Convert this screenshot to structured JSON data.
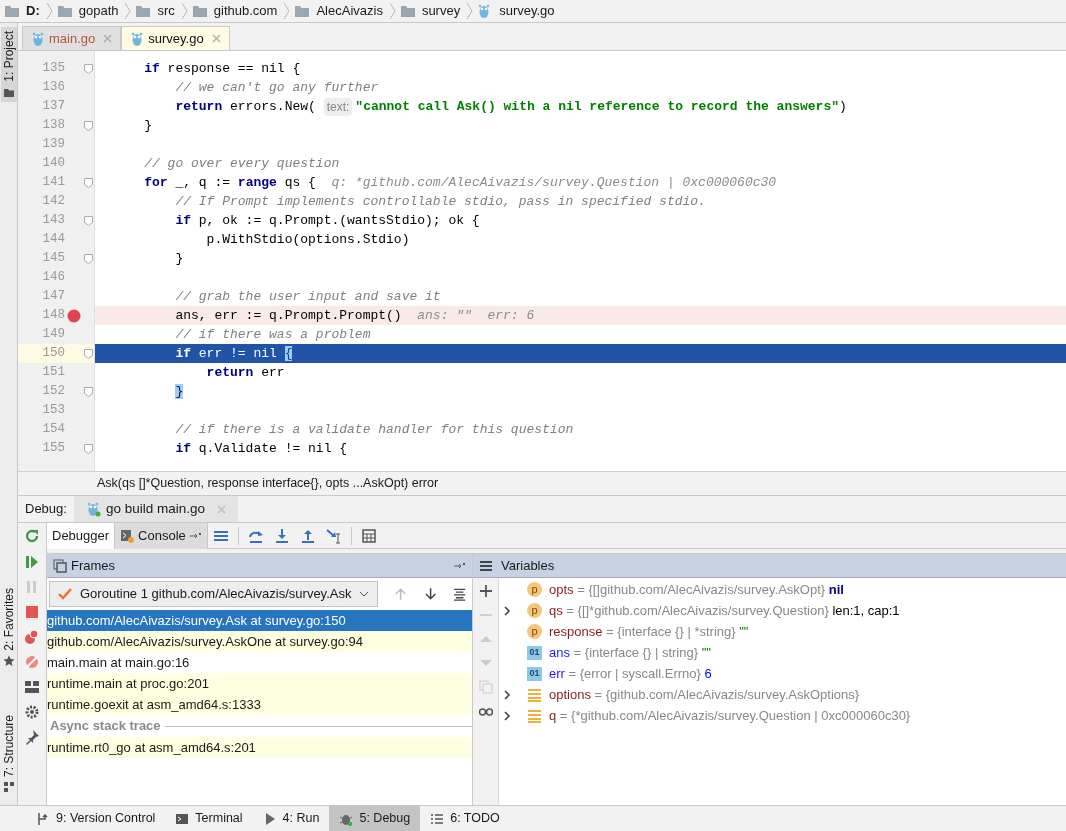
{
  "breadcrumbs": [
    {
      "label": "D:",
      "kind": "drive"
    },
    {
      "label": "gopath",
      "kind": "folder"
    },
    {
      "label": "src",
      "kind": "folder"
    },
    {
      "label": "github.com",
      "kind": "folder"
    },
    {
      "label": "AlecAivazis",
      "kind": "folder"
    },
    {
      "label": "survey",
      "kind": "folder"
    },
    {
      "label": "survey.go",
      "kind": "file"
    }
  ],
  "side_tools": [
    {
      "label": "1: Project",
      "kind": "project"
    },
    {
      "label": "2: Favorites",
      "kind": "favorites"
    },
    {
      "label": "7: Structure",
      "kind": "structure"
    }
  ],
  "editor_tabs": [
    {
      "label": "main.go",
      "selected": false
    },
    {
      "label": "survey.go",
      "selected": true
    }
  ],
  "code_lines": [
    {
      "number": "135",
      "fold": true,
      "breakpoint": false,
      "current": false,
      "segments": [
        {
          "kind": "keyword",
          "t": "    if"
        },
        {
          "kind": "plain",
          "t": " response == nil {"
        }
      ]
    },
    {
      "number": "136",
      "fold": false,
      "breakpoint": false,
      "current": false,
      "segments": [
        {
          "kind": "comment",
          "t": "        // we can't go any further"
        }
      ]
    },
    {
      "number": "137",
      "fold": false,
      "breakpoint": false,
      "current": false,
      "segments": [
        {
          "kind": "keyword",
          "t": "        return"
        },
        {
          "kind": "plain",
          "t": " errors.New( "
        },
        {
          "kind": "inlay",
          "t": "text:"
        },
        {
          "kind": "string",
          "t": "\"cannot call Ask() with a nil reference to record the answers\""
        },
        {
          "kind": "plain",
          "t": ")"
        }
      ]
    },
    {
      "number": "138",
      "fold": true,
      "breakpoint": false,
      "current": false,
      "segments": [
        {
          "kind": "plain",
          "t": "    }"
        }
      ]
    },
    {
      "number": "139",
      "fold": false,
      "breakpoint": false,
      "current": false
    },
    {
      "number": "140",
      "fold": false,
      "breakpoint": false,
      "current": false,
      "segments": [
        {
          "kind": "comment",
          "t": "    // go over every question"
        }
      ]
    },
    {
      "number": "141",
      "fold": true,
      "breakpoint": false,
      "current": false,
      "segments": [
        {
          "kind": "keyword",
          "t": "    for"
        },
        {
          "kind": "plain",
          "t": " _, q := "
        },
        {
          "kind": "keyword",
          "t": "range"
        },
        {
          "kind": "plain",
          "t": " qs {  "
        },
        {
          "kind": "hint",
          "t": "q: *github.com/AlecAivazis/survey.Question | 0xc000060c30"
        }
      ]
    },
    {
      "number": "142",
      "fold": false,
      "breakpoint": false,
      "current": false,
      "segments": [
        {
          "kind": "comment",
          "t": "        // If Prompt implements controllable stdio, pass in specified stdio."
        }
      ]
    },
    {
      "number": "143",
      "fold": true,
      "breakpoint": false,
      "current": false,
      "segments": [
        {
          "kind": "keyword",
          "t": "        if"
        },
        {
          "kind": "plain",
          "t": " p, ok := q.Prompt.(wantsStdio); ok {"
        }
      ]
    },
    {
      "number": "144",
      "fold": false,
      "breakpoint": false,
      "current": false,
      "segments": [
        {
          "kind": "plain",
          "t": "            p.WithStdio(options.Stdio)"
        }
      ]
    },
    {
      "number": "145",
      "fold": true,
      "breakpoint": false,
      "current": false,
      "segments": [
        {
          "kind": "plain",
          "t": "        }"
        }
      ]
    },
    {
      "number": "146",
      "fold": false,
      "breakpoint": false,
      "current": false
    },
    {
      "number": "147",
      "fold": false,
      "breakpoint": false,
      "current": false,
      "segments": [
        {
          "kind": "comment",
          "t": "        // grab the user input and save it"
        }
      ]
    },
    {
      "number": "148",
      "fold": false,
      "breakpoint": true,
      "current": false,
      "segments": [
        {
          "kind": "plain",
          "t": "        ans, err := q.Prompt.Prompt()  "
        },
        {
          "kind": "hint",
          "t": "ans: \"\"  err: 6"
        }
      ]
    },
    {
      "number": "149",
      "fold": false,
      "breakpoint": false,
      "current": false,
      "segments": [
        {
          "kind": "comment",
          "t": "        // if there was a problem"
        }
      ]
    },
    {
      "number": "150",
      "fold": true,
      "breakpoint": false,
      "current": true,
      "segments": [
        {
          "kind": "keyword",
          "t": "        if"
        },
        {
          "kind": "plain",
          "t": " err != nil "
        },
        {
          "kind": "brace",
          "t": "{"
        }
      ]
    },
    {
      "number": "151",
      "fold": false,
      "breakpoint": false,
      "current": false,
      "segments": [
        {
          "kind": "keyword",
          "t": "            return"
        },
        {
          "kind": "plain",
          "t": " err"
        }
      ]
    },
    {
      "number": "152",
      "fold": true,
      "breakpoint": false,
      "current": false,
      "segments": [
        {
          "kind": "brace",
          "t": "        }"
        }
      ]
    },
    {
      "number": "153",
      "fold": false,
      "breakpoint": false,
      "current": false
    },
    {
      "number": "154",
      "fold": false,
      "breakpoint": false,
      "current": false,
      "segments": [
        {
          "kind": "comment",
          "t": "        // if there is a validate handler for this question"
        }
      ]
    },
    {
      "number": "155",
      "fold": true,
      "breakpoint": false,
      "current": false,
      "segments": [
        {
          "kind": "keyword",
          "t": "        if"
        },
        {
          "kind": "plain",
          "t": " q.Validate != nil {"
        }
      ]
    }
  ],
  "signature_hint": "Ask(qs []*Question, response interface{}, opts ...AskOpt) error",
  "debug": {
    "label": "Debug:",
    "session_tab": "go build main.go",
    "view_tabs": [
      {
        "label": "Debugger",
        "selected": true
      },
      {
        "label": "Console",
        "selected": false
      }
    ],
    "frames": {
      "title": "Frames",
      "goroutine": "Goroutine 1 github.com/AlecAivazis/survey.Ask",
      "items": [
        {
          "kind": "library",
          "label": "github.com/AlecAivazis/survey.Ask at survey.go:150",
          "selected": true
        },
        {
          "kind": "library",
          "label": "github.com/AlecAivazis/survey.AskOne at survey.go:94",
          "selected": false
        },
        {
          "kind": "user",
          "label": "main.main at main.go:16",
          "selected": false
        },
        {
          "kind": "library",
          "label": "runtime.main at proc.go:201",
          "selected": false
        },
        {
          "kind": "library",
          "label": "runtime.goexit at asm_amd64.s:1333",
          "selected": false
        },
        {
          "kind": "header",
          "label": "Async stack trace"
        },
        {
          "kind": "library",
          "label": "runtime.rt0_go at asm_amd64.s:201",
          "selected": false
        }
      ]
    },
    "variables": {
      "title": "Variables",
      "items": [
        {
          "kind": "param",
          "badge": "p",
          "expandable": false,
          "name": "opts",
          "type": "= {[]github.com/AlecAivazis/survey.AskOpt}",
          "value": {
            "kind": "nil",
            "text": "nil"
          }
        },
        {
          "kind": "param",
          "badge": "p",
          "expandable": true,
          "name": "qs",
          "type": "= {[]*github.com/AlecAivazis/survey.Question}",
          "value": {
            "kind": "plain",
            "text": "len:1, cap:1"
          }
        },
        {
          "kind": "param",
          "badge": "p",
          "expandable": false,
          "name": "response",
          "type": "= {interface {} | *string}",
          "value": {
            "kind": "string",
            "text": "\"\""
          }
        },
        {
          "kind": "local",
          "badge": "01",
          "expandable": false,
          "name": "ans",
          "type": "= {interface {} | string}",
          "value": {
            "kind": "string",
            "text": "\"\""
          }
        },
        {
          "kind": "local",
          "badge": "01",
          "expandable": false,
          "name": "err",
          "type": "= {error | syscall.Errno}",
          "value": {
            "kind": "number",
            "text": "6"
          }
        },
        {
          "kind": "struct",
          "expandable": true,
          "name": "options",
          "type": "= {github.com/AlecAivazis/survey.AskOptions}"
        },
        {
          "kind": "struct",
          "expandable": true,
          "name": "q",
          "type": "= {*github.com/AlecAivazis/survey.Question | 0xc000060c30}"
        }
      ]
    }
  },
  "bottom_tools": [
    {
      "label": "9: Version Control",
      "kind": "vcs",
      "selected": false
    },
    {
      "label": "Terminal",
      "kind": "terminal",
      "selected": false
    },
    {
      "label": "4: Run",
      "kind": "run",
      "selected": false
    },
    {
      "label": "5: Debug",
      "kind": "debug",
      "selected": true
    },
    {
      "label": "6: TODO",
      "kind": "todo",
      "selected": false
    }
  ]
}
